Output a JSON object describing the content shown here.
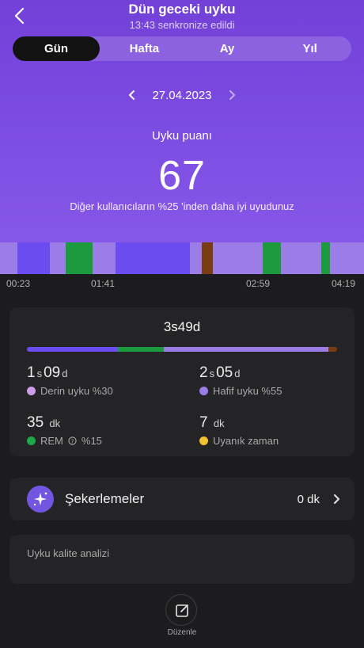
{
  "header": {
    "title": "Dün geceki uyku",
    "subtitle": "13:43 senkronize edildi"
  },
  "tabs": [
    {
      "label": "Gün",
      "active": true
    },
    {
      "label": "Hafta",
      "active": false
    },
    {
      "label": "Ay",
      "active": false
    },
    {
      "label": "Yıl",
      "active": false
    }
  ],
  "date": {
    "value": "27.04.2023",
    "prev_icon": "chevron-left-icon",
    "next_icon": "chevron-right-icon"
  },
  "score": {
    "label": "Uyku puanı",
    "value": "67",
    "comparison": "Diğer kullanıcıların %25 'inden daha iyi uyudunuz"
  },
  "timeline": {
    "ticks": [
      "00:23",
      "01:41",
      "02:59",
      "04:19"
    ]
  },
  "summary": {
    "total": "3s49d",
    "stages": {
      "deep": {
        "value": "1",
        "unit1": "s",
        "value2": "09",
        "unit2": "d",
        "label": "Derin uyku %30",
        "color": "#d09ce8",
        "share": 0.3
      },
      "light": {
        "value": "2",
        "unit1": "s",
        "value2": "05",
        "unit2": "d",
        "label": "Hafif uyku %55",
        "color": "#9a7ce8",
        "share": 0.55
      },
      "rem": {
        "value": "35",
        "unit": "dk",
        "label_pre": "REM",
        "label_post": "%15",
        "color": "#1fa84a",
        "share": 0.15
      },
      "awake": {
        "value": "7",
        "unit": "dk",
        "label": "Uyanık zaman",
        "color": "#f2c230"
      }
    }
  },
  "naps": {
    "label": "Şekerlemeler",
    "value": "0 dk"
  },
  "quality": {
    "label": "Uyku kalite analizi"
  },
  "edit": {
    "label": "Düzenle"
  },
  "colors": {
    "accent": "#7d4ce2",
    "deep_bar": "#6a4cf0",
    "light_bar": "#9c7ce6",
    "rem_bar": "#1c9a3e",
    "awake_bar": "#7a3d12"
  }
}
